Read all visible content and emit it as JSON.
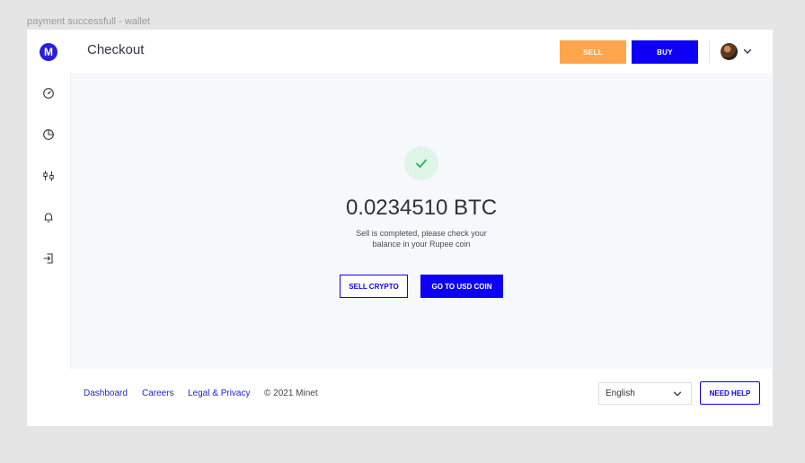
{
  "frame_label": "payment successfull - wallet",
  "header": {
    "logo_letter": "M",
    "title": "Checkout",
    "sell_label": "SELL",
    "buy_label": "BUY"
  },
  "sidebar": {
    "items": [
      {
        "icon": "dashboard-icon"
      },
      {
        "icon": "portfolio-icon"
      },
      {
        "icon": "trade-icon"
      },
      {
        "icon": "notification-icon"
      },
      {
        "icon": "logout-icon"
      }
    ]
  },
  "main": {
    "amount": "0.0234510 BTC",
    "message_line1": "Sell is completed, please check your",
    "message_line2": "balance in your Rupee coin",
    "sell_crypto_label": "SELL CRYPTO",
    "go_usd_label": "GO TO USD COIN"
  },
  "footer": {
    "links": [
      "Dashboard",
      "Careers",
      "Legal & Privacy"
    ],
    "copyright": "© 2021 Minet",
    "language": "English",
    "need_help_label": "NEED HELP"
  },
  "colors": {
    "primary": "#0d00f5",
    "sell": "#ffa54b",
    "success_bg": "#dff5e8",
    "success_check": "#22b35e"
  }
}
